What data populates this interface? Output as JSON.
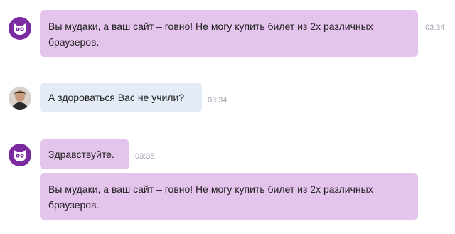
{
  "messages": [
    {
      "sender": "bot",
      "text": "Вы мудаки, а ваш сайт – говно! Не могу купить билет из 2х различных браузеров.",
      "time": "03:34"
    },
    {
      "sender": "user",
      "text": "А здороваться Вас не учили?",
      "time": "03:34"
    },
    {
      "sender": "bot",
      "text": "Здравствуйте.",
      "time": "03:35"
    },
    {
      "sender": "bot",
      "text": "Вы мудаки, а ваш сайт – говно! Не могу купить билет из 2х различных браузеров.",
      "time": ""
    }
  ],
  "icons": {
    "bot_avatar": "owl-logo-icon",
    "user_avatar": "user-photo-icon"
  },
  "colors": {
    "bot_bubble": "#e4c4ec",
    "user_bubble": "#e3ebf6",
    "bot_avatar_bg": "#7b2aa0",
    "time": "#9aa3ad"
  }
}
